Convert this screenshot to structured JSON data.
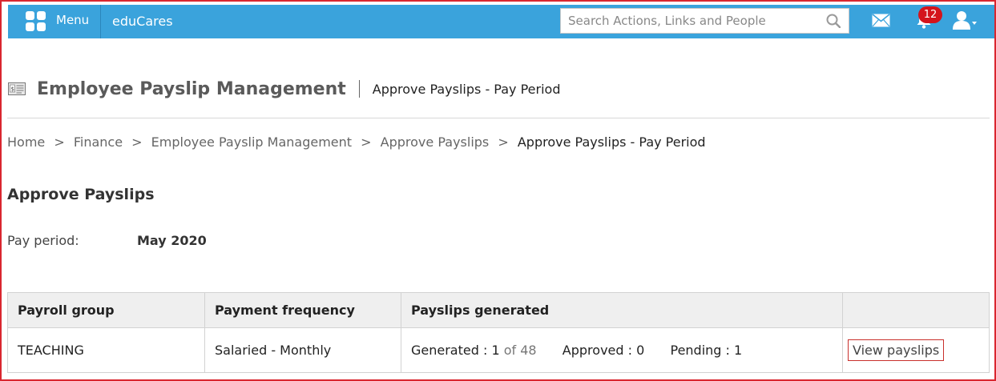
{
  "topbar": {
    "menu_label": "Menu",
    "app_name": "eduCares",
    "search_placeholder": "Search Actions, Links and People",
    "notification_count": "12",
    "color": "#3aa3dc"
  },
  "header": {
    "title": "Employee Payslip Management",
    "subtitle": "Approve Payslips - Pay Period"
  },
  "breadcrumb": {
    "items": [
      "Home",
      "Finance",
      "Employee Payslip Management",
      "Approve Payslips"
    ],
    "separator": ">",
    "current": "Approve Payslips - Pay Period"
  },
  "section": {
    "title": "Approve Payslips",
    "pay_period_label": "Pay period:",
    "pay_period_value": "May 2020"
  },
  "table": {
    "headers": [
      "Payroll group",
      "Payment frequency",
      "Payslips generated",
      ""
    ],
    "rows": [
      {
        "payroll_group": "TEACHING",
        "payment_frequency": "Salaried - Monthly",
        "generated_label": "Generated :",
        "generated_value": "1",
        "generated_of": "of 48",
        "approved_label": "Approved :",
        "approved_value": "0",
        "pending_label": "Pending :",
        "pending_value": "1",
        "action_label": "View payslips"
      }
    ]
  }
}
